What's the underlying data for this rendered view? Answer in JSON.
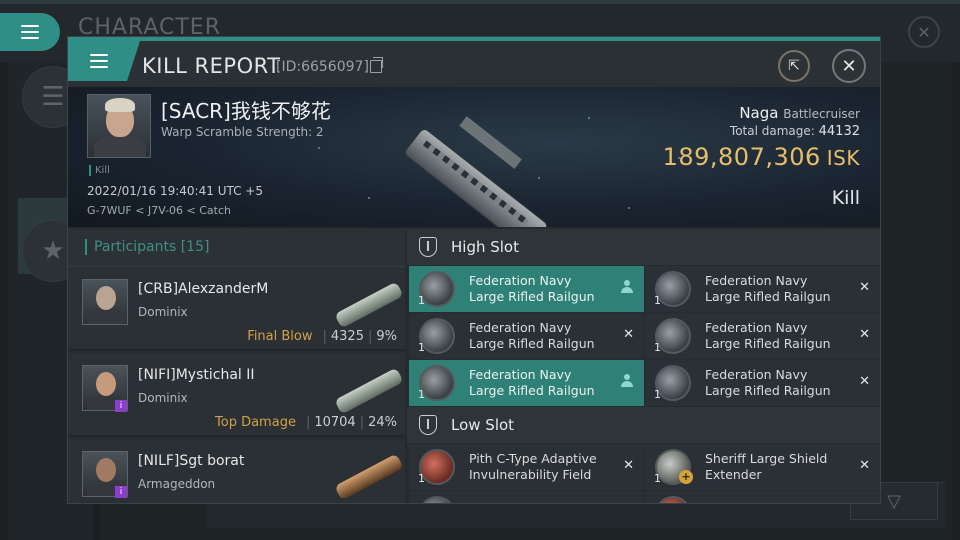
{
  "background": {
    "title": "CHARACTER"
  },
  "modal": {
    "title": "KILL REPORT",
    "id_text": "[ID:6656097]"
  },
  "victim": {
    "name": "[SACR]我钱不够花",
    "warp_scramble": "Warp Scramble Strength: 2",
    "tag": "Kill",
    "datetime": "2022/01/16 19:40:41 UTC +5",
    "location": "G-7WUF < J7V-06 < Catch",
    "ship_name": "Naga",
    "ship_class": "Battlecruiser",
    "total_damage_label": "Total damage:",
    "total_damage": "44132",
    "isk_value": "189,807,306",
    "isk_unit": "ISK",
    "result": "Kill"
  },
  "participants": {
    "title": "Participants",
    "count": "[15]",
    "items": [
      {
        "name": "[CRB]AlexzanderM",
        "ship": "Dominix",
        "tag": "Final Blow",
        "damage": "4325",
        "percent": "9%",
        "badge": ""
      },
      {
        "name": "[NIFI]Mystichal II",
        "ship": "Dominix",
        "tag": "Top Damage",
        "damage": "10704",
        "percent": "24%",
        "badge": "i"
      },
      {
        "name": "[NILF]Sgt borat",
        "ship": "Armageddon",
        "tag": "",
        "damage": "",
        "percent": "",
        "badge": "i"
      }
    ]
  },
  "fitting": {
    "high_slot_title": "High Slot",
    "low_slot_title": "Low Slot",
    "high_slot": [
      {
        "line1": "Federation Navy",
        "line2": "Large Rifled Railgun",
        "qty": "1",
        "state": "person"
      },
      {
        "line1": "Federation Navy",
        "line2": "Large Rifled Railgun",
        "qty": "1",
        "state": "x"
      },
      {
        "line1": "Federation Navy",
        "line2": "Large Rifled Railgun",
        "qty": "1",
        "state": "x"
      },
      {
        "line1": "Federation Navy",
        "line2": "Large Rifled Railgun",
        "qty": "1",
        "state": "x"
      },
      {
        "line1": "Federation Navy",
        "line2": "Large Rifled Railgun",
        "qty": "1",
        "state": "person"
      },
      {
        "line1": "Federation Navy",
        "line2": "Large Rifled Railgun",
        "qty": "1",
        "state": "x"
      }
    ],
    "low_slot": [
      {
        "line1": "Pith C-Type Adaptive",
        "line2": "Invulnerability Field",
        "qty": "1",
        "state": "x"
      },
      {
        "line1": "Sheriff Large Shield",
        "line2": "Extender",
        "qty": "1",
        "state": "x"
      }
    ]
  },
  "icons": {
    "menu": "hamburger-icon",
    "share": "external-link-icon",
    "close": "close-icon",
    "copy": "copy-icon",
    "filter": "filter-icon"
  },
  "colors": {
    "accent": "#2f8f86",
    "isk": "#e8be6a",
    "tag": "#d1a049",
    "badge": "#8b3ec9"
  }
}
